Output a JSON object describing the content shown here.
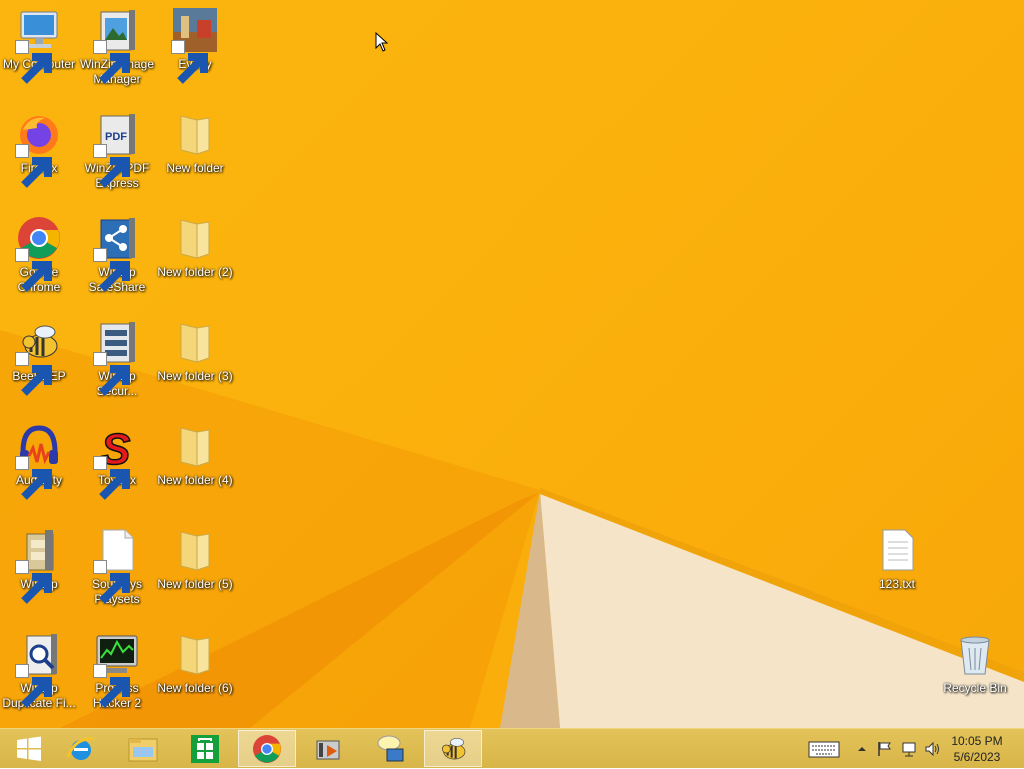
{
  "desktop": {
    "icons": [
      {
        "label": "My Computer",
        "icon": "computer-icon"
      },
      {
        "label": "WinZip Image Manager",
        "icon": "winzip-image-icon"
      },
      {
        "label": "Evony",
        "icon": "evony-icon"
      },
      {
        "label": "Firefox",
        "icon": "firefox-icon"
      },
      {
        "label": "WinZip PDF Express",
        "icon": "winzip-pdf-icon"
      },
      {
        "label": "New folder",
        "icon": "folder-icon"
      },
      {
        "label": "Google Chrome",
        "icon": "chrome-icon"
      },
      {
        "label": "WinZip SafeShare",
        "icon": "winzip-safeshare-icon"
      },
      {
        "label": "New folder (2)",
        "icon": "folder-icon"
      },
      {
        "label": "BeeBEEP",
        "icon": "beebeep-icon"
      },
      {
        "label": "WinZip Secur...",
        "icon": "winzip-secure-icon"
      },
      {
        "label": "New folder (3)",
        "icon": "folder-icon"
      },
      {
        "label": "Audacity",
        "icon": "audacity-icon"
      },
      {
        "label": "Toybox",
        "icon": "toybox-icon"
      },
      {
        "label": "New folder (4)",
        "icon": "folder-icon"
      },
      {
        "label": "WinZip",
        "icon": "winzip-icon"
      },
      {
        "label": "Souptoys Playsets",
        "icon": "blank-file-icon"
      },
      {
        "label": "New folder (5)",
        "icon": "folder-icon"
      },
      {
        "label": "WinZip Duplicate Fi...",
        "icon": "winzip-duplicate-icon"
      },
      {
        "label": "Process Hacker 2",
        "icon": "process-hacker-icon"
      },
      {
        "label": "New folder (6)",
        "icon": "folder-icon"
      },
      {
        "label": "123.txt",
        "icon": "text-file-icon"
      },
      {
        "label": "Recycle Bin",
        "icon": "recycle-bin-icon"
      }
    ]
  },
  "taskbar": {
    "buttons": [
      {
        "name": "start-button",
        "icon": "windows-logo-icon"
      },
      {
        "name": "internet-explorer-button",
        "icon": "internet-explorer-icon"
      },
      {
        "name": "file-explorer-button",
        "icon": "file-explorer-icon"
      },
      {
        "name": "store-button",
        "icon": "store-icon"
      },
      {
        "name": "chrome-button",
        "icon": "chrome-icon"
      },
      {
        "name": "media-button",
        "icon": "media-icon"
      },
      {
        "name": "messenger-button",
        "icon": "messenger-icon"
      },
      {
        "name": "beebeep-button",
        "icon": "beebeep-icon"
      }
    ],
    "tray": {
      "icons": [
        "keyboard-icon",
        "chevron-up-icon",
        "flag-icon",
        "network-icon",
        "volume-icon"
      ]
    },
    "clock": {
      "time": "10:05 PM",
      "date": "5/6/2023"
    }
  },
  "colors": {
    "wallpaper": "#fbb10c",
    "taskbar": "#dcb84e"
  }
}
